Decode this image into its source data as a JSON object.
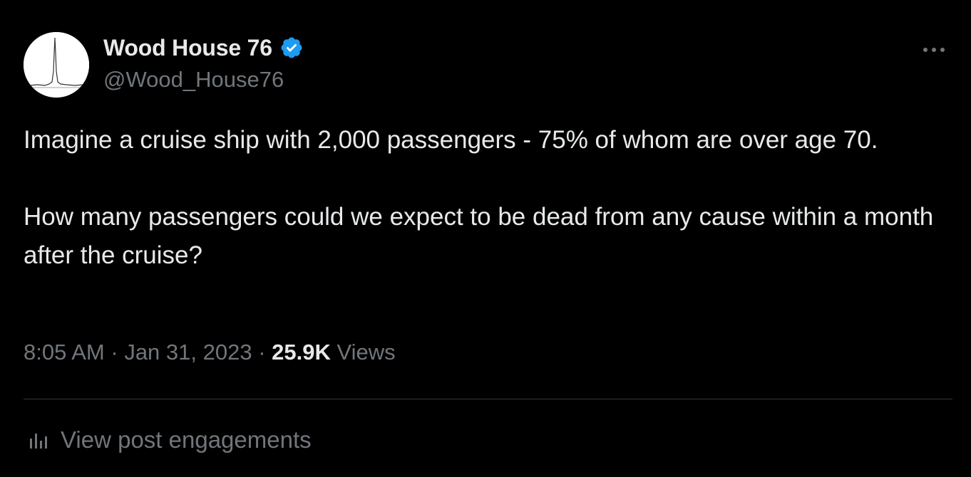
{
  "author": {
    "display_name": "Wood House 76",
    "handle": "@Wood_House76",
    "verified": true,
    "avatar_icon": "spike-graph-avatar"
  },
  "post": {
    "paragraphs": [
      "Imagine a cruise ship with 2,000 passengers - 75% of whom are over age 70.",
      "How many passengers could we expect to be dead from any cause within a month after the cruise?"
    ]
  },
  "meta": {
    "time": "8:05 AM",
    "separator": "·",
    "date": "Jan 31, 2023",
    "views_count": "25.9K",
    "views_label": "Views"
  },
  "actions": {
    "more_icon": "more-horizontal-icon",
    "engagements_label": "View post engagements",
    "engagements_icon": "analytics-bars-icon"
  },
  "colors": {
    "background": "#000000",
    "primary_text": "#e7e9ea",
    "secondary_text": "#71767b",
    "verified_blue": "#1d9bf0",
    "divider": "#2f3336"
  }
}
